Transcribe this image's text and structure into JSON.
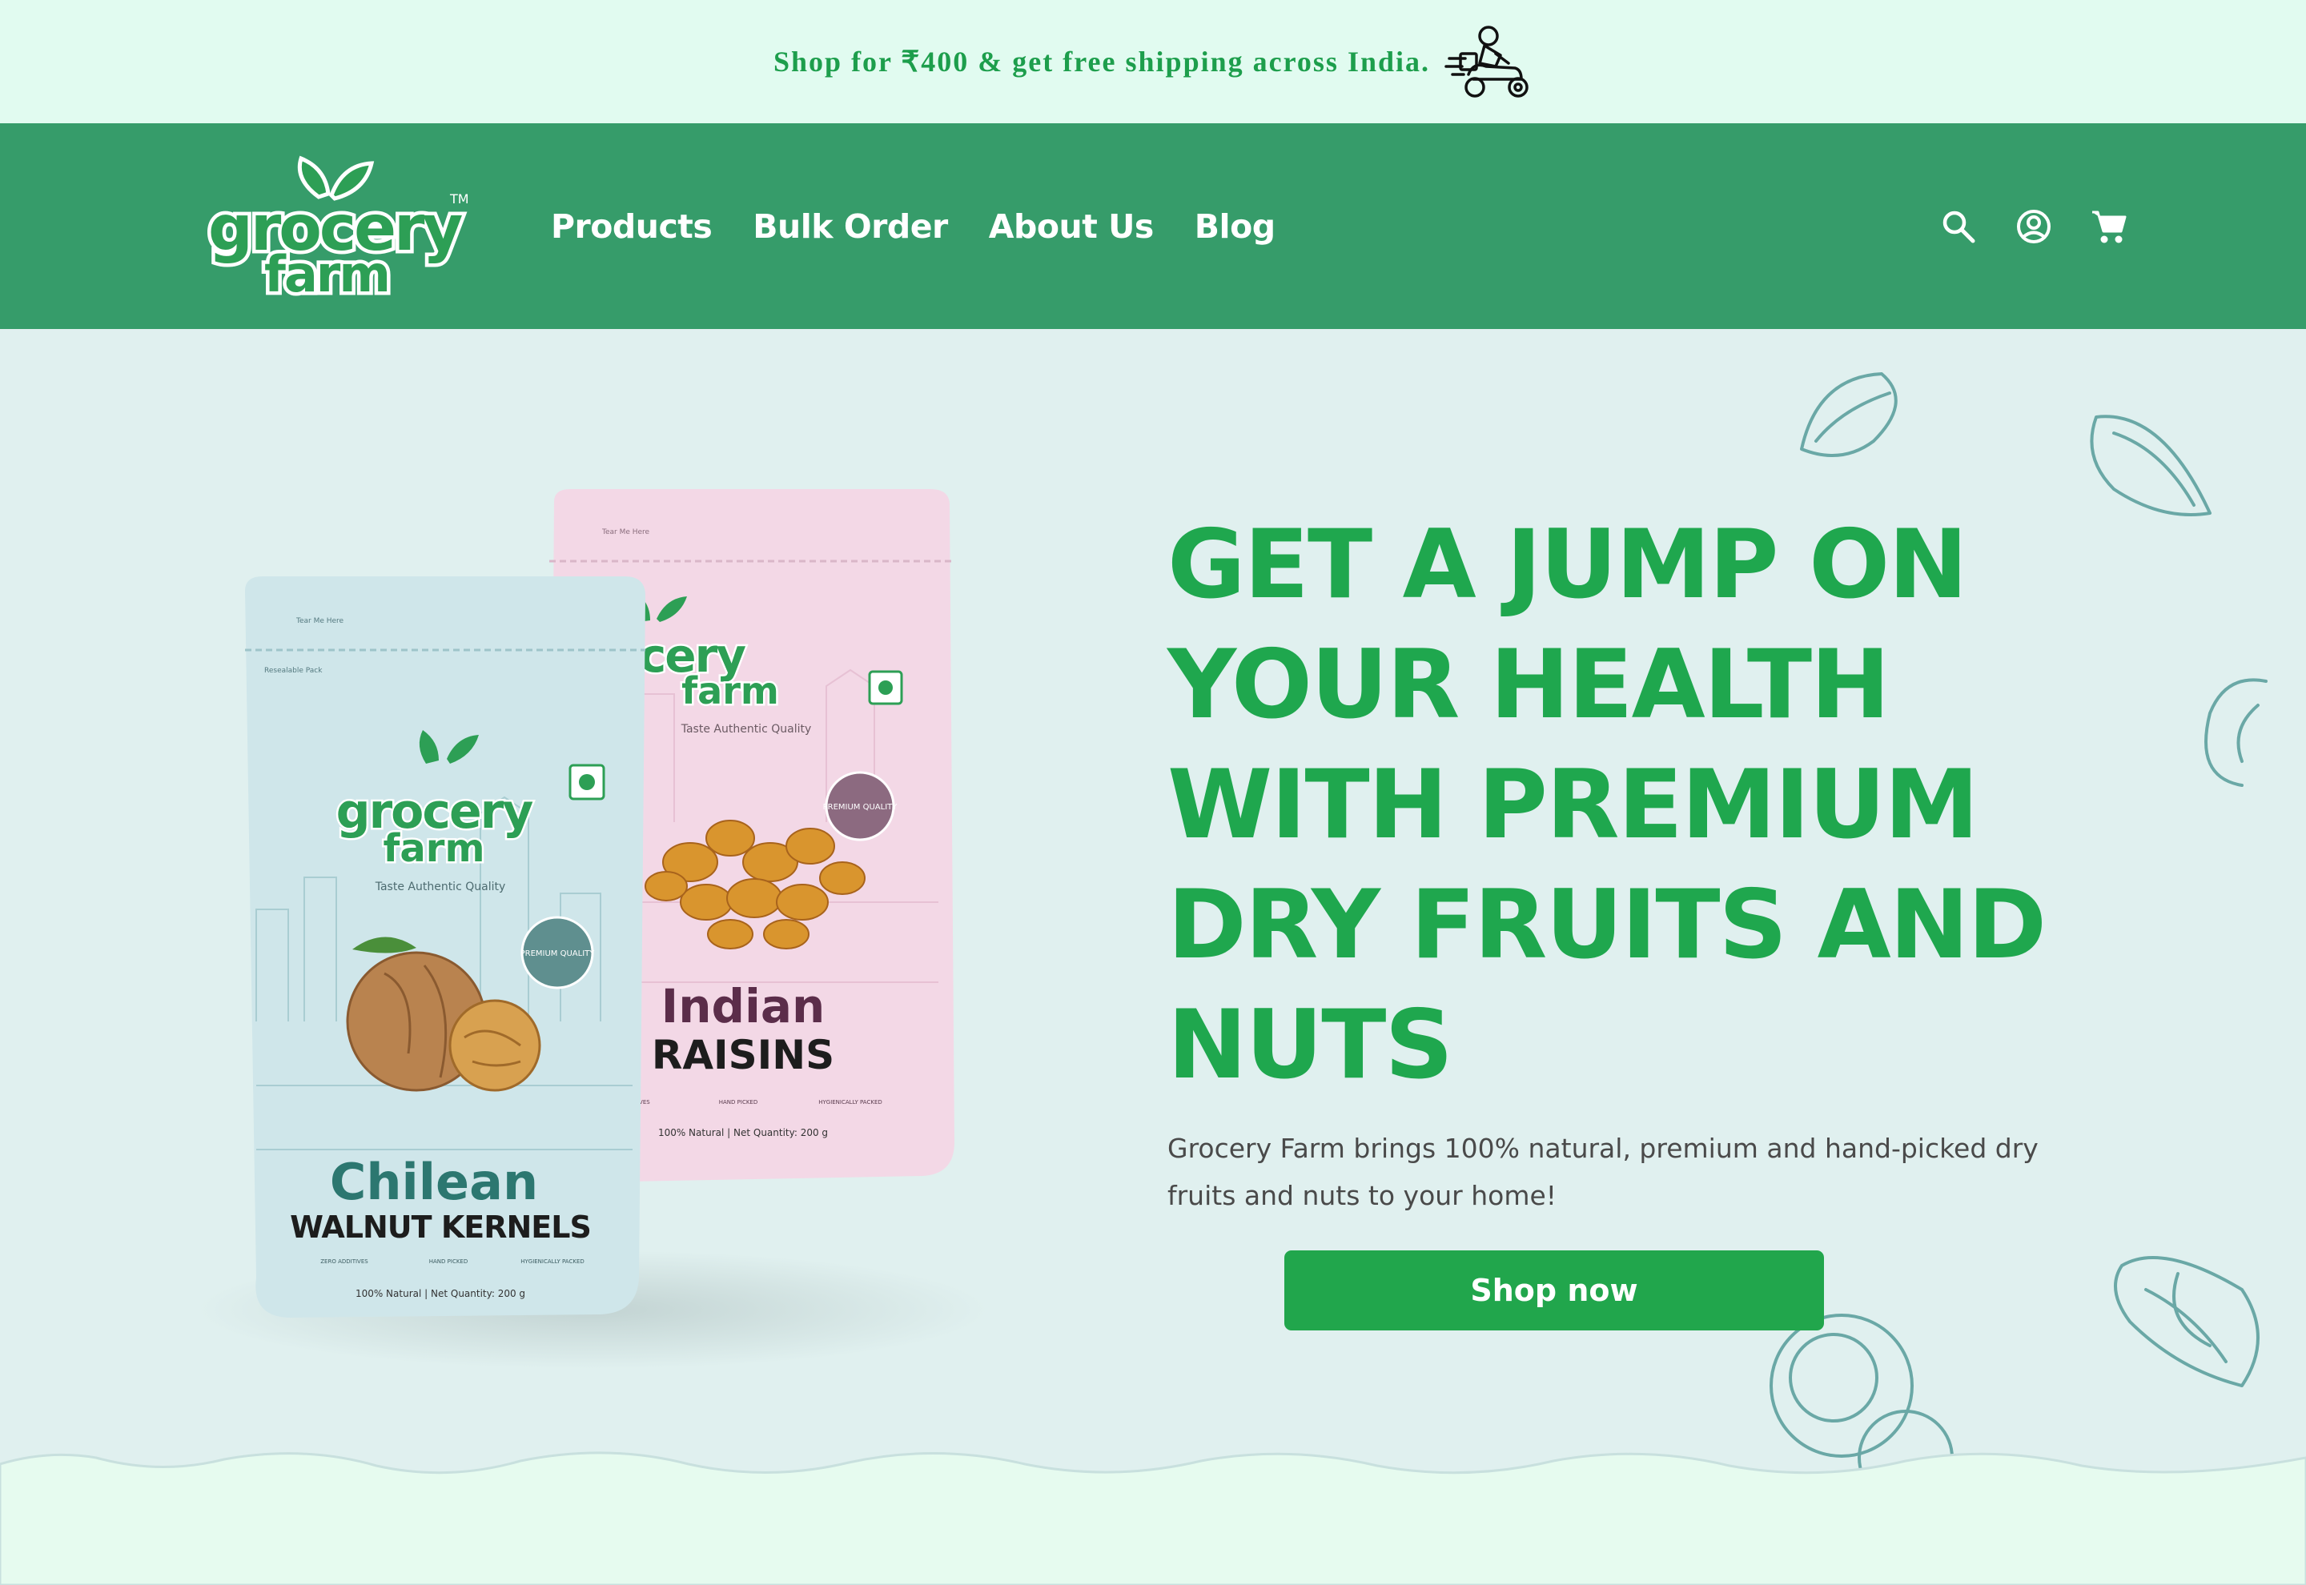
{
  "announcement": {
    "text": "Shop for ₹400 & get free shipping across India."
  },
  "header": {
    "logo_text_top": "grocery",
    "logo_text_bottom": "farm",
    "logo_tm": "TM",
    "nav": [
      {
        "label": "Products"
      },
      {
        "label": "Bulk Order"
      },
      {
        "label": "About Us"
      },
      {
        "label": "Blog"
      }
    ],
    "icons": [
      "search-icon",
      "account-icon",
      "cart-icon"
    ]
  },
  "hero": {
    "headline": "GET A JUMP ON YOUR HEALTH WITH PREMIUM DRY FRUITS AND NUTS",
    "subtext": "Grocery Farm brings 100% natural, premium and hand-picked dry fruits and nuts to your home!",
    "cta_label": "Shop now"
  },
  "products": [
    {
      "brand_top": "grocery",
      "brand_bottom": "farm",
      "tagline": "Taste Authentic Quality",
      "badge": "PREMIUM QUALITY",
      "name_line1": "Chilean",
      "name_line2": "WALNUT KERNELS",
      "features": [
        "ZERO ADDITIVES",
        "HAND PICKED",
        "HYGIENICALLY PACKED"
      ],
      "footer": "100% Natural | Net Quantity: 200 g",
      "tear": "Tear Me Here",
      "resealable": "Resealable Pack"
    },
    {
      "brand_top": "grocery",
      "brand_bottom": "farm",
      "tagline": "Taste Authentic Quality",
      "badge": "PREMIUM QUALITY",
      "name_line1": "Indian",
      "name_line2": "RAISINS",
      "features": [
        "ZERO ADDITIVES",
        "HAND PICKED",
        "HYGIENICALLY PACKED"
      ],
      "footer": "100% Natural | Net Quantity: 200 g",
      "tear": "Tear Me Here"
    }
  ],
  "colors": {
    "announce_bg": "#e1fbf0",
    "header_bg": "#369c6a",
    "hero_bg": "#e0f0ef",
    "accent_green": "#1fa74e",
    "button_green": "#21a64c",
    "walnut_pouch": "#cfe6ea",
    "raisin_pouch": "#f3d8e6"
  }
}
